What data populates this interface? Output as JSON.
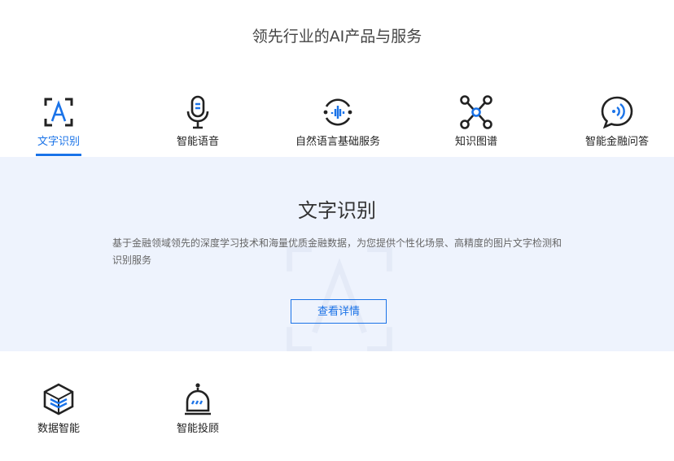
{
  "section_title": "领先行业的AI产品与服务",
  "tabs": [
    {
      "label": "文字识别",
      "icon": "text-recognition-icon",
      "active": true
    },
    {
      "label": "智能语音",
      "icon": "microphone-icon",
      "active": false
    },
    {
      "label": "自然语言基础服务",
      "icon": "voice-wave-icon",
      "active": false
    },
    {
      "label": "知识图谱",
      "icon": "knowledge-graph-icon",
      "active": false
    },
    {
      "label": "智能金融问答",
      "icon": "chat-bubble-icon",
      "active": false
    },
    {
      "label": "数据智能",
      "icon": "data-cube-icon",
      "active": false
    },
    {
      "label": "智能投顾",
      "icon": "robot-advisor-icon",
      "active": false
    }
  ],
  "panel": {
    "heading": "文字识别",
    "description": "基于金融领域领先的深度学习技术和海量优质金融数据，为您提供个性化场景、高精度的图片文字检测和识别服务",
    "button_label": "查看详情"
  },
  "colors": {
    "accent": "#1a73e8",
    "panel_bg": "#eef3fd"
  }
}
